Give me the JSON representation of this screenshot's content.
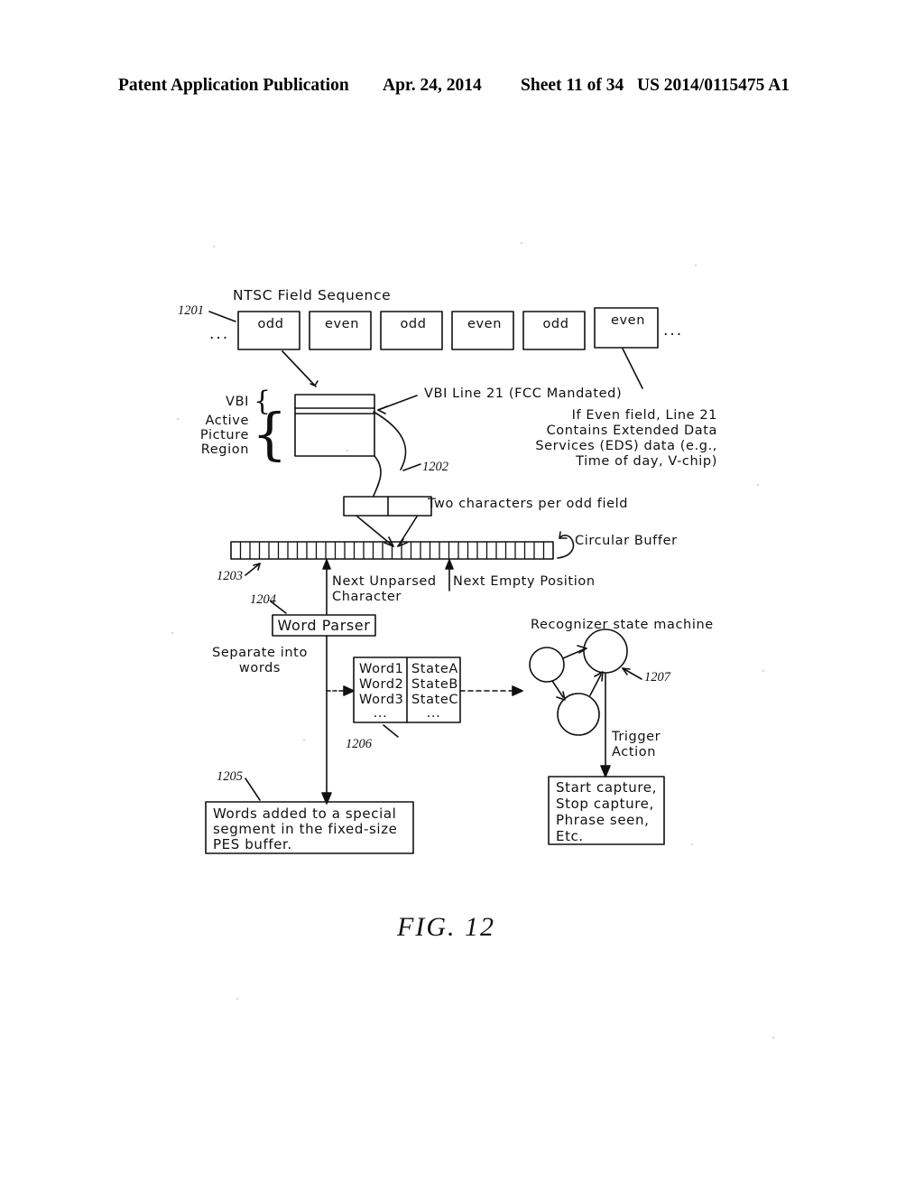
{
  "header": {
    "publication": "Patent Application Publication",
    "date": "Apr. 24, 2014",
    "sheet": "Sheet 11 of 34",
    "number": "US 2014/0115475 A1"
  },
  "figure": {
    "label": "FIG. 12",
    "title": "NTSC Field Sequence"
  },
  "field_sequence": {
    "ref": "1201",
    "leading_ellipsis": "...",
    "trailing_ellipsis": "...",
    "fields": [
      {
        "label": "odd"
      },
      {
        "label": "even"
      },
      {
        "label": "odd"
      },
      {
        "label": "even"
      },
      {
        "label": "odd"
      },
      {
        "label": "even"
      }
    ]
  },
  "frame_detail": {
    "vbi_label": "VBI",
    "active_region_label_line1": "Active",
    "active_region_label_line2": "Picture",
    "active_region_label_line3": "Region",
    "callout_line21": "VBI Line 21 (FCC Mandated)",
    "ref_1202": "1202",
    "eds_note_line1": "If Even field, Line 21",
    "eds_note_line2": "Contains Extended Data",
    "eds_note_line3": "Services (EDS) data (e.g.,",
    "eds_note_line4": "Time of day, V-chip)"
  },
  "char_pair": {
    "caption": "Two characters per odd field"
  },
  "circular_buffer": {
    "ref": "1203",
    "label": "Circular Buffer",
    "cell_count": 34,
    "pointers": [
      {
        "name": "next-unparsed-character",
        "label_line1": "Next Unparsed",
        "label_line2": "Character",
        "cell_index": 11
      },
      {
        "name": "next-empty-position",
        "label_line1": "Next Empty Position",
        "label_line2": "",
        "cell_index": 22
      }
    ]
  },
  "word_parser": {
    "ref": "1204",
    "label": "Word Parser",
    "separate_note_line1": "Separate into",
    "separate_note_line2": "words"
  },
  "word_state_table": {
    "ref": "1206",
    "rows": [
      {
        "word": "Word1",
        "state": "StateA"
      },
      {
        "word": "Word2",
        "state": "StateB"
      },
      {
        "word": "Word3",
        "state": "StateC"
      },
      {
        "word": "...",
        "state": "..."
      }
    ]
  },
  "recognizer": {
    "ref": "1207",
    "title": "Recognizer state machine",
    "trigger_line1": "Trigger",
    "trigger_line2": "Action"
  },
  "pes_box": {
    "ref": "1205",
    "line1": "Words added to a special",
    "line2": "segment in the fixed-size",
    "line3": "PES buffer."
  },
  "actions_box": {
    "lines": [
      "Start capture,",
      "Stop capture,",
      "Phrase seen,",
      "Etc."
    ]
  },
  "colors": {
    "ink": "#111111",
    "paper": "#ffffff"
  }
}
